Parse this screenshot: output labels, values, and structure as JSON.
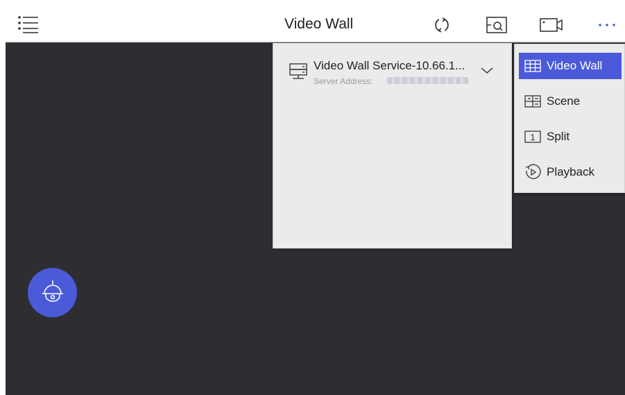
{
  "header": {
    "title": "Video Wall",
    "menu_icon": "hamburger-list-icon",
    "refresh_icon": "refresh-icon",
    "search_window_icon": "window-search-icon",
    "camera_icon": "video-camera-icon",
    "more_icon": "more-dots-icon"
  },
  "service": {
    "name": "Video Wall Service-10.66.1...",
    "address_label": "Server Address:",
    "icon": "server-icon",
    "expand_icon": "chevron-down-icon"
  },
  "menu": {
    "items": [
      {
        "label": "Video Wall",
        "icon": "grid-wall-icon",
        "active": true
      },
      {
        "label": "Scene",
        "icon": "scene-icon",
        "active": false
      },
      {
        "label": "Split",
        "icon": "split-1-icon",
        "active": false
      },
      {
        "label": "Playback",
        "icon": "playback-icon",
        "active": false
      }
    ],
    "split_glyph": "1"
  },
  "fab": {
    "icon": "ptz-dome-camera-icon"
  },
  "colors": {
    "accent": "#4a5ad8",
    "canvas": "#2e2e32",
    "panel": "#ebebeb"
  }
}
